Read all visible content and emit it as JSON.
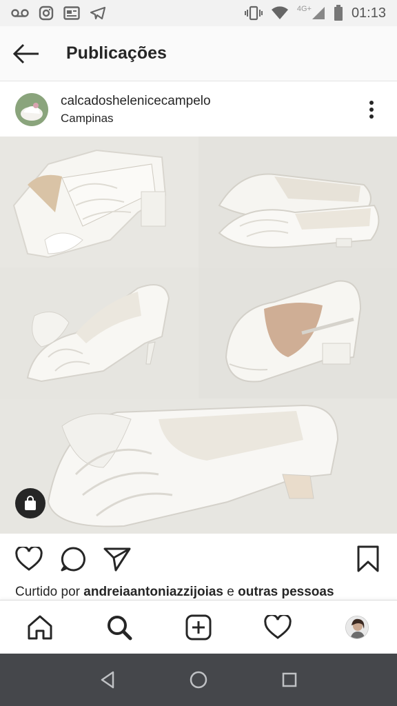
{
  "status_bar": {
    "time": "01:13",
    "network_label": "4G+",
    "icons": [
      "voicemail-icon",
      "instagram-icon",
      "news-icon",
      "telegram-icon",
      "vibrate-icon",
      "wifi-icon",
      "signal-icon",
      "battery-icon"
    ]
  },
  "header": {
    "title": "Publicações",
    "back_icon": "arrow-left-icon"
  },
  "post": {
    "username": "calcadoshelenicecampelo",
    "location": "Campinas",
    "more_icon": "more-vertical-icon",
    "image_description_icons": [
      "shopping-bag-icon"
    ],
    "actions": [
      "heart-icon",
      "comment-icon",
      "share-icon",
      "bookmark-icon"
    ],
    "likes": {
      "prefix": "Curtido por ",
      "user": "andreiaantoniazzijoias",
      "middle": " e ",
      "others": "outras pessoas"
    }
  },
  "bottom_nav": {
    "items": [
      "home-icon",
      "search-icon",
      "add-post-icon",
      "activity-icon",
      "profile-avatar"
    ]
  },
  "android_nav": {
    "items": [
      "back-triangle-icon",
      "home-circle-icon",
      "recents-square-icon"
    ],
    "color": "#45474b"
  },
  "colors": {
    "text": "#262626",
    "background": "#ffffff",
    "header_bg": "#fafafa",
    "status_bg": "#f2f2f2",
    "photo_bg": "#ecebe6"
  }
}
